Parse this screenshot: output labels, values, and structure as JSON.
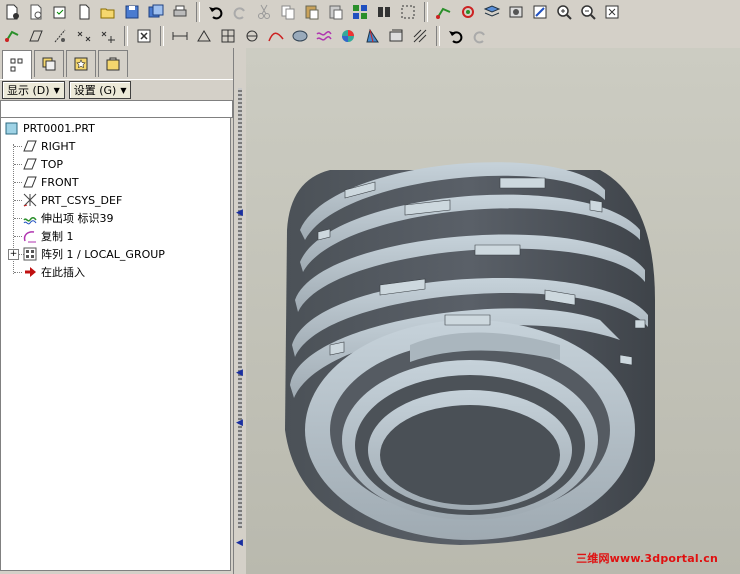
{
  "toolbar": {
    "row1": [
      "new-icon",
      "open-icon",
      "save-icon",
      "print-icon",
      "undo-icon",
      "redo-icon",
      "cut-icon",
      "copy-icon",
      "paste-icon",
      "find-icon",
      "select-icon",
      "datum-icon",
      "zoom-in-icon",
      "zoom-out-icon"
    ],
    "row2": [
      "datum-point-icon",
      "datum-plane-icon",
      "datum-axis-icon",
      "coord-sys-icon",
      "close-icon",
      "measure-icon",
      "analysis-icon",
      "section-icon",
      "curvature-icon",
      "shade-icon",
      "spin-icon",
      "undo-icon",
      "redo-icon"
    ]
  },
  "left_panel": {
    "tabs": [
      "model-tree-tab",
      "layers-tab",
      "favorites-tab",
      "connections-tab"
    ],
    "display_menu": "显示 (D)",
    "settings_menu": "设置 (G)"
  },
  "model_tree": {
    "items": [
      {
        "label": "PRT0001.PRT",
        "icon": "part-icon"
      },
      {
        "label": "RIGHT",
        "icon": "datum-plane-icon"
      },
      {
        "label": "TOP",
        "icon": "datum-plane-icon"
      },
      {
        "label": "FRONT",
        "icon": "datum-plane-icon"
      },
      {
        "label": "PRT_CSYS_DEF",
        "icon": "coord-sys-icon"
      },
      {
        "label": "伸出项  标识39",
        "icon": "protrusion-icon"
      },
      {
        "label": "复制  1",
        "icon": "copy-feature-icon"
      },
      {
        "label": "阵列  1 / LOCAL_GROUP",
        "icon": "pattern-icon"
      },
      {
        "label": "在此插入",
        "icon": "insert-here-arrow-icon"
      }
    ]
  },
  "watermark": "三维网www.3dportal.cn",
  "colors": {
    "ui_gray": "#d4d0c8",
    "viewport_bg": "#c4c4ba",
    "part_light": "#b8c4cc",
    "part_dark": "#4e545a"
  }
}
